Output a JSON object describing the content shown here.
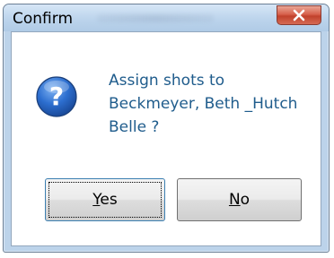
{
  "window": {
    "title": "Confirm"
  },
  "message": {
    "line1": "Assign shots to",
    "line2": "Beckmeyer, Beth _Hutch",
    "line3": "Belle ?"
  },
  "buttons": {
    "yes": {
      "accel": "Y",
      "rest": "es"
    },
    "no": {
      "accel": "N",
      "rest": "o"
    }
  },
  "icons": {
    "message_icon": "question-icon",
    "close_icon": "close-icon"
  },
  "colors": {
    "close_button": "#c74a35",
    "message_text": "#1f5c8c",
    "icon_blue": "#2d6fd0"
  }
}
